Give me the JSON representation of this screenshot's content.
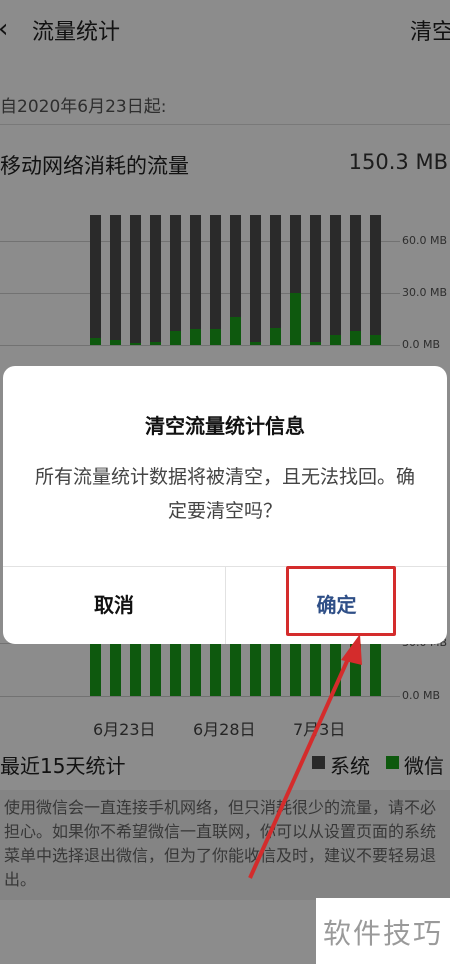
{
  "header": {
    "back_icon": "chevron-left-icon",
    "back_glyph": "‹",
    "title": "流量统计",
    "clear_label": "清空"
  },
  "since_label": "自2020年6月23日起:",
  "mobile": {
    "title": "移动网络消耗的流量",
    "total": "150.3 MB"
  },
  "legend": {
    "recent_label": "最近15天统计",
    "system_label": "系统",
    "wechat_label": "微信"
  },
  "tip": "使用微信会一直连接手机网络，但只消耗很少的流量，请不必担心。如果你不希望微信一直联网，你可以从设置页面的系统菜单中选择退出微信，但为了你能收信及时，建议不要轻易退出。",
  "dialog": {
    "title": "清空流量统计信息",
    "message": "所有流量统计数据将被清空，且无法找回。确定要清空吗？",
    "cancel_label": "取消",
    "confirm_label": "确定"
  },
  "watermark": "软件技巧",
  "colors": {
    "system": "#4d4d4d",
    "wechat": "#1aa31a",
    "confirm": "#2f4f87",
    "highlight": "#d42c2c"
  },
  "chart_data": [
    {
      "type": "bar",
      "categories": [
        "6月23日",
        "",
        "",
        "",
        "",
        "6月28日",
        "",
        "",
        "",
        "",
        "7月3日",
        "",
        "",
        "",
        ""
      ],
      "series": [
        {
          "name": "系统",
          "values": [
            75,
            75,
            75,
            75,
            75,
            75,
            75,
            75,
            75,
            75,
            75,
            75,
            75,
            75,
            75
          ]
        },
        {
          "name": "微信",
          "values": [
            4,
            3,
            1,
            2,
            8,
            9,
            9,
            16,
            2,
            10,
            30,
            2,
            6,
            8,
            6
          ]
        }
      ],
      "stacked": false,
      "yticks": [
        "60.0 MB",
        "30.0 MB",
        "0.0 MB"
      ],
      "ylim": [
        0,
        75
      ]
    },
    {
      "type": "bar",
      "categories": [
        "6月23日",
        "",
        "",
        "",
        "",
        "6月28日",
        "",
        "",
        "",
        "",
        "7月3日",
        "",
        "",
        "",
        ""
      ],
      "series": [
        {
          "name": "微信",
          "values": [
            36,
            36,
            36,
            36,
            36,
            36,
            36,
            36,
            36,
            36,
            36,
            36,
            36,
            36,
            36
          ]
        }
      ],
      "yticks": [
        "30.0 MB",
        "0.0 MB"
      ],
      "ylim": [
        0,
        36
      ]
    }
  ]
}
